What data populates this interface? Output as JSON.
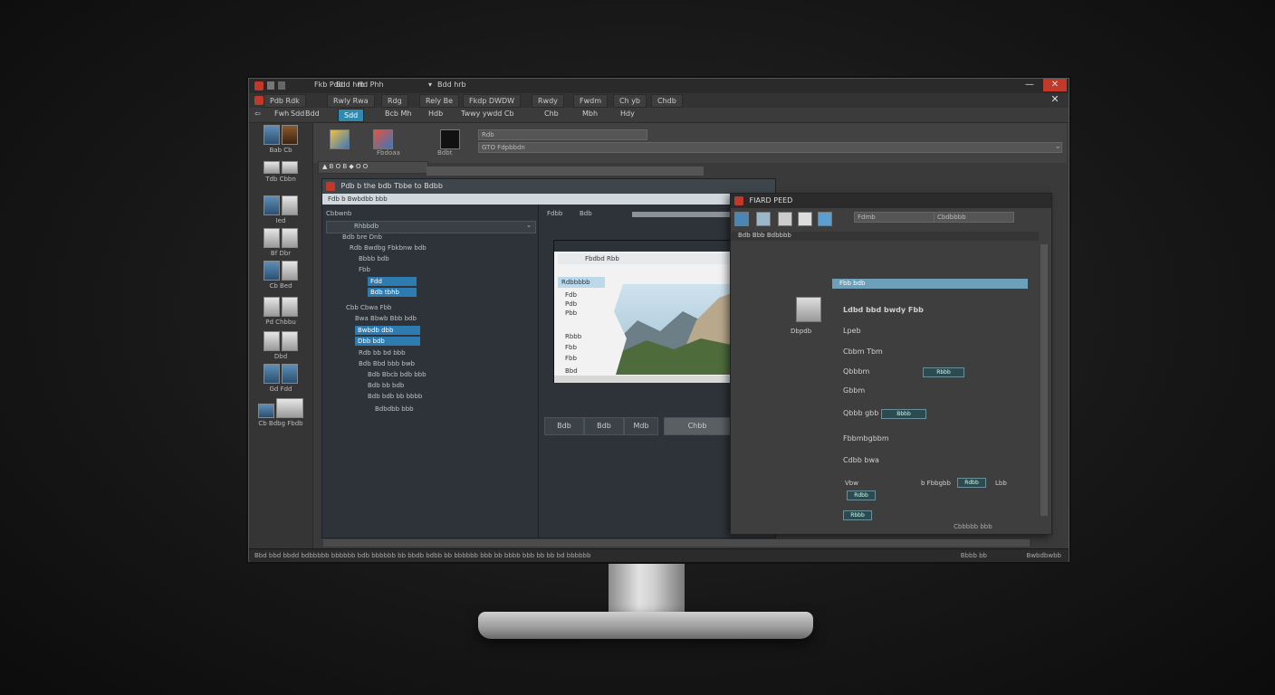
{
  "app": {
    "title_menu": [
      "Fkb Pdd",
      "Bdd hrb",
      "Hd Phh"
    ],
    "tabs": [
      "Pdb  Rdk",
      "Rwly  Rwa",
      "Rdg",
      "Rely  Be",
      "Fkdp  DWDW",
      "Rwdy",
      "Fwdm",
      "Ch  yb",
      "Chdb"
    ],
    "ribbon_tabs": [
      "Fwh",
      "Sdd",
      "Bdd",
      "Bcb Mh",
      "Hdb",
      "Twwy  ywdd Cb",
      "Chb",
      "Mbh",
      "Hdy"
    ]
  },
  "ribbon": {
    "labels": [
      "Fbdoaa",
      "Bdbt"
    ],
    "field1": "Rdb",
    "field2": "GTO Fdpbbdn",
    "toolbar_icons": [
      "A",
      "B",
      "O",
      "B",
      "B",
      "O",
      "O"
    ]
  },
  "left_panel": [
    {
      "label": "Bab  Cb"
    },
    {
      "label": "Tdb Cbbn"
    },
    {
      "label": "Ied"
    },
    {
      "label": "Bf  Dbr"
    },
    {
      "label": "Cb  Bed"
    },
    {
      "label": "Pd Chbbu"
    },
    {
      "label": "Dbd"
    },
    {
      "label": "Gd  Fdd"
    },
    {
      "label": "Cb Bdbg Fbdb"
    }
  ],
  "editor": {
    "title": "Pdb  b  the  bdb  Tbbe  to  Bdbb",
    "address": "Fdb  b  Bwbdbb bbb",
    "tree_header": "Cbbwnb",
    "tree_items": [
      "Rhbbdb",
      "Bdb bre Dnb",
      "Rdb Bwdbg Fbkbnw bdb",
      "Bbbb bdb",
      "Fbb",
      "Fdd",
      "Bdb tbhb",
      "Cbb Cbwa Fbb",
      "Bwa Bbwb Bbb bdb",
      "Bwbdb dbb",
      "Dbb bdb",
      "Rdb bb bd bbb",
      "Bdb Bbd bbb bwb",
      "Bdb Bbcb bdb bbb",
      "Bdb bb bdb",
      "Bdb bdb bb bbbb",
      "Bdbdbb bbb"
    ],
    "preview_tabs": [
      "Fdbb",
      "Bdb"
    ],
    "preview_doc_title": "Fbdbd Rbb",
    "preview_rows": [
      "Rdbbbbb",
      "Fdb",
      "Pdb",
      "Pbb",
      "Rbbb",
      "Fbb",
      "Fbb",
      "Bbd"
    ],
    "buttons": [
      "Bdb",
      "Bdb",
      "Mdb",
      "Chbb"
    ]
  },
  "properties": {
    "title": "FIARD  PEED",
    "dropdown1": "Fdmb",
    "dropdown2": "Cbdbbbb",
    "crumb": "Bdb  Bbb  Bdbbbb",
    "items": [
      {
        "label": "Fbb bdb",
        "kind": "selected"
      },
      {
        "label": "Ldbd bbd bwdy Fbb",
        "kind": "header"
      },
      {
        "label": "Lpeb",
        "prefix": "Dbpdb"
      },
      {
        "label": "Cbbm Tbm"
      },
      {
        "label": "Qbbbm",
        "button": "Rbbb"
      },
      {
        "label": "Gbbm"
      },
      {
        "label": "Qbbb gbb",
        "button": "Bbbb"
      },
      {
        "label": "Fbbmbgbbm"
      },
      {
        "label": "Cdbb bwa"
      },
      {
        "label": "Vbw",
        "mid": "b Fbbgbb",
        "tail": "Lbb",
        "button": "Rdbb"
      },
      {
        "label": "",
        "button": "Rbbb"
      }
    ],
    "footer": "Cbbbbb  bbb"
  },
  "status": {
    "text": "Bbd  bbd bbdd bdbbbbb  bbbbbb bdb  bbbbbb  bb  bbdb  bdbb bb bbbbbb  bbb  bb  bbbb bbb bb  bb  bd  bbbbbb",
    "right": [
      "Bbbb bb",
      "Bwbdbwbb"
    ]
  }
}
